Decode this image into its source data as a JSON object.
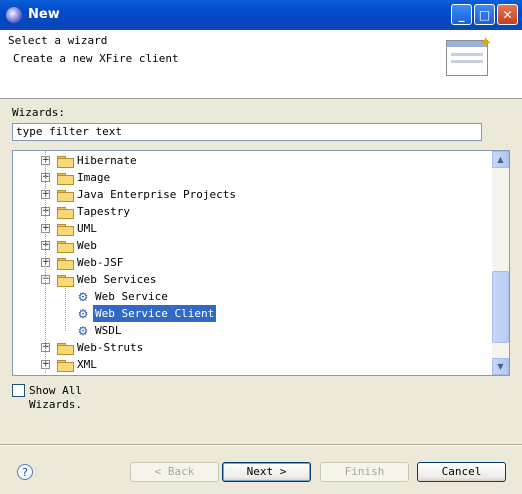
{
  "window": {
    "title": "New"
  },
  "header": {
    "title": "Select a wizard",
    "description": "Create a new XFire client"
  },
  "wizards": {
    "label": "Wizards:",
    "filter_value": "type filter text",
    "tree": [
      {
        "label": "Hibernate",
        "type": "folder",
        "expanded": false
      },
      {
        "label": "Image",
        "type": "folder",
        "expanded": false
      },
      {
        "label": "Java Enterprise Projects",
        "type": "folder",
        "expanded": false
      },
      {
        "label": "Tapestry",
        "type": "folder",
        "expanded": false
      },
      {
        "label": "UML",
        "type": "folder",
        "expanded": false
      },
      {
        "label": "Web",
        "type": "folder",
        "expanded": false
      },
      {
        "label": "Web-JSF",
        "type": "folder",
        "expanded": false
      },
      {
        "label": "Web Services",
        "type": "folder",
        "expanded": true
      },
      {
        "label": "Web Service",
        "type": "item"
      },
      {
        "label": "Web Service Client",
        "type": "item",
        "selected": true
      },
      {
        "label": "WSDL",
        "type": "item"
      },
      {
        "label": "Web-Struts",
        "type": "folder",
        "expanded": false
      },
      {
        "label": "XML",
        "type": "folder",
        "expanded": false
      }
    ]
  },
  "show_all": {
    "label": "Show All Wizards.",
    "checked": false
  },
  "buttons": {
    "back": "< Back",
    "next": "Next >",
    "finish": "Finish",
    "cancel": "Cancel"
  },
  "help_glyph": "?",
  "icons": {
    "app": "eclipse-icon",
    "help": "help-icon",
    "wizard": "wizard-banner-icon"
  }
}
